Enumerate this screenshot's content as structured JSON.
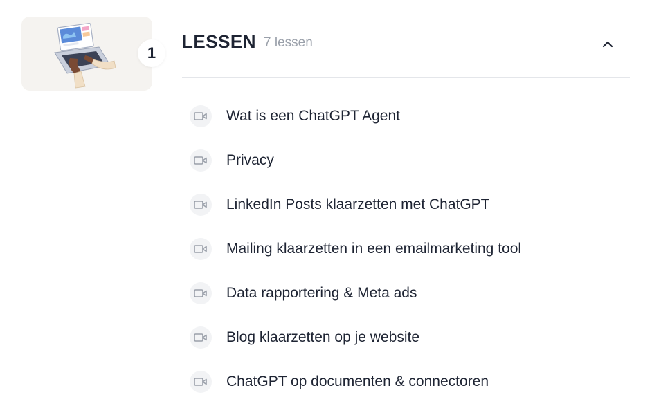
{
  "module": {
    "number": "1",
    "title": "LESSEN",
    "lesson_count": "7 lessen",
    "collapse_icon": "chevron-up-icon",
    "thumbnail_icon": "laptop-illustration"
  },
  "lessons": [
    {
      "label": "Wat is een ChatGPT Agent",
      "icon": "video-camera-icon"
    },
    {
      "label": "Privacy",
      "icon": "video-camera-icon"
    },
    {
      "label": "LinkedIn Posts klaarzetten met ChatGPT",
      "icon": "video-camera-icon"
    },
    {
      "label": "Mailing klaarzetten in een emailmarketing tool",
      "icon": "video-camera-icon"
    },
    {
      "label": "Data rapportering & Meta ads",
      "icon": "video-camera-icon"
    },
    {
      "label": "Blog klaarzetten op je website",
      "icon": "video-camera-icon"
    },
    {
      "label": "ChatGPT op documenten & connectoren",
      "icon": "video-camera-icon"
    }
  ],
  "colors": {
    "text": "#1e2433",
    "muted": "#9aa0aa",
    "divider": "#e4e6ea",
    "icon_bg": "#f2f3f5",
    "icon_stroke": "#9aa0aa",
    "thumb_bg": "#f5f3f0"
  }
}
